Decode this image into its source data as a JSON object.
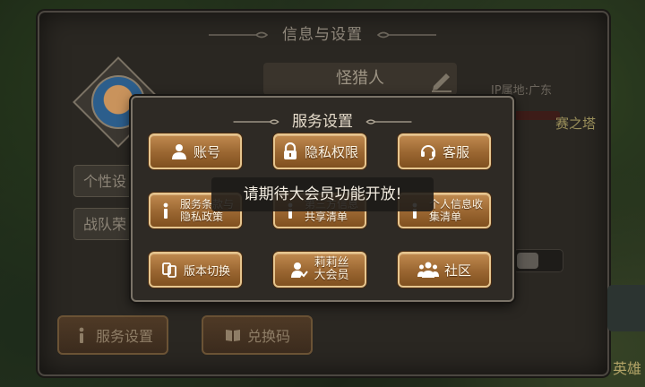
{
  "main_panel": {
    "title": "信息与设置",
    "player_name": "怪猎人",
    "ip_location": "IP属地:广东",
    "right_text": "赛之塔",
    "side_buttons": [
      "个性设",
      "战队荣"
    ],
    "bottom_buttons": {
      "service": "服务设置",
      "redeem": "兑换码"
    },
    "edge_text": "英雄"
  },
  "service_popup": {
    "title": "服务设置",
    "buttons": {
      "account": "账号",
      "privacy": "隐私权限",
      "support": "客服",
      "terms": "服务条款与\n隐私政策",
      "third_party": "第三方信息\n共享清单",
      "personal_info": "个人信息收\n集清单",
      "version_switch": "版本切换",
      "vip": "莉莉丝\n大会员",
      "community": "社区"
    }
  },
  "toast": {
    "message": "请期待大会员功能开放!"
  },
  "colors": {
    "button_gold": "#9a6631",
    "button_border": "#e6c58e",
    "panel_bg": "#2e2a25",
    "icon_white": "#ffffff"
  },
  "icons": [
    "user-icon",
    "lock-icon",
    "headset-icon",
    "info-icon",
    "switch-icon",
    "vip-user-icon",
    "community-icon",
    "pencil-icon",
    "book-icon"
  ]
}
